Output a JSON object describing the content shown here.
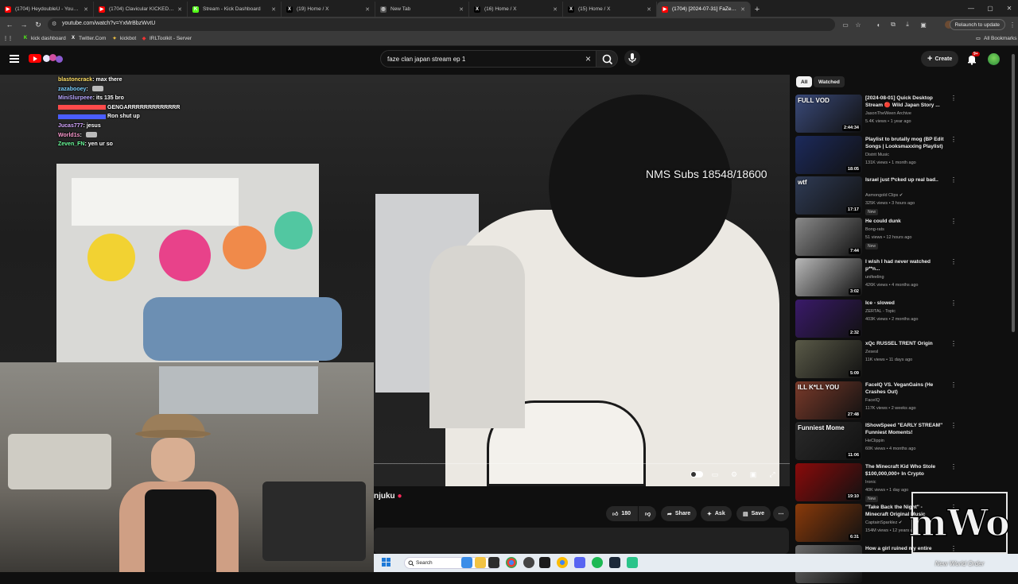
{
  "browser": {
    "tabs": [
      {
        "label": "(1704) HeydoubleU - YouTube",
        "fav": "▶",
        "favcolor": "#ff0000",
        "active": false
      },
      {
        "label": "(1704) Clavicular KICKED OUT",
        "fav": "▶",
        "favcolor": "#ff0000",
        "active": false
      },
      {
        "label": "Stream - Kick Dashboard",
        "fav": "K",
        "favcolor": "#53fc18",
        "active": false
      },
      {
        "label": "(19) Home / X",
        "fav": "X",
        "favcolor": "#000000",
        "active": false
      },
      {
        "label": "New Tab",
        "fav": "◎",
        "favcolor": "#555555",
        "active": false
      },
      {
        "label": "(16) Home / X",
        "fav": "X",
        "favcolor": "#000000",
        "active": false
      },
      {
        "label": "(15) Home / X",
        "fav": "X",
        "favcolor": "#000000",
        "active": false
      },
      {
        "label": "(1704) [2024-07-31] FaZe J...",
        "fav": "▶",
        "favcolor": "#ff0000",
        "active": true
      }
    ],
    "url": "youtube.com/watch?v=YxMrBbzWvtU",
    "relaunch_label": "Relaunch to update",
    "bookmarks": [
      {
        "label": "kick dashboard",
        "icon": "K",
        "color": "#53fc18"
      },
      {
        "label": "Twitter.Com",
        "icon": "X",
        "color": "#ffffff"
      },
      {
        "label": "kickbot",
        "icon": "✦",
        "color": "#f5c542"
      },
      {
        "label": "IRLToolkit - Server",
        "icon": "◆",
        "color": "#e33"
      }
    ],
    "all_bookmarks_label": "All Bookmarks"
  },
  "youtube": {
    "search_query": "faze clan japan stream ep 1",
    "create_label": "Create",
    "notif_count": "9+",
    "video_title_fragment": "njuku",
    "like_count": "180",
    "share_label": "Share",
    "ask_label": "Ask",
    "save_label": "Save"
  },
  "overlay": {
    "subs_counter": "NMS Subs 18548/18600",
    "chat": [
      {
        "user": "blastoncrack",
        "text": "max there",
        "color": "#ffe066"
      },
      {
        "user": "zazabooey",
        "text": "",
        "color": "#7ad1ff"
      },
      {
        "user": "MiniSlurpeee",
        "text": "its 135 bro",
        "color": "#b9a7ff"
      },
      {
        "user": "",
        "text": "GENGARRRRRRRRRRRRR",
        "color": "#ff4a4a"
      },
      {
        "user": "",
        "text": "Ron shut up",
        "color": "#4a5dff"
      },
      {
        "user": "Jucas777",
        "text": "jesus",
        "color": "#d6a7ff"
      },
      {
        "user": "World1s",
        "text": "",
        "color": "#ff9bd1"
      },
      {
        "user": "Zeven_FN",
        "text": "yen ur so",
        "color": "#6cff9c"
      }
    ]
  },
  "sidebar": {
    "chips": [
      "All",
      "Watched"
    ],
    "videos": [
      {
        "title": "[2024-08-01] Quick Desktop Stream 🔴 Wild Japan Story ...",
        "channel": "JasonTheWeen Archive",
        "views": "5.4K views • 1 year ago",
        "duration": "2:44:34",
        "new": false,
        "thumbcolor": "#3a4a7a",
        "thumbtext": "FULL VOD"
      },
      {
        "title": "Playlist to brutally mog (BP Edit Songs | Looksmaxxing Playlist)",
        "channel": "Distrit Music",
        "views": "131K views • 1 month ago",
        "duration": "18:05",
        "new": false,
        "thumbcolor": "#1c2a5c",
        "thumbtext": ""
      },
      {
        "title": "Israel just f*cked up real bad..",
        "channel": "Asmongold Clips ✔",
        "views": "325K views • 3 hours ago",
        "duration": "17:17",
        "new": true,
        "thumbcolor": "#2f3b55",
        "thumbtext": "wtf"
      },
      {
        "title": "He could dunk",
        "channel": "Bong-rats",
        "views": "51 views • 12 hours ago",
        "duration": "7:44",
        "new": true,
        "thumbcolor": "#8a8a8a",
        "thumbtext": ""
      },
      {
        "title": "I wish I had never watched p**n...",
        "channel": "unifeeling",
        "views": "426K views • 4 months ago",
        "duration": "3:02",
        "new": false,
        "thumbcolor": "#b9b9b9",
        "thumbtext": ""
      },
      {
        "title": "Ice - slowed",
        "channel": "ZERTAL - Topic",
        "views": "403K views • 2 months ago",
        "duration": "2:32",
        "new": false,
        "thumbcolor": "#3a1a6a",
        "thumbtext": ""
      },
      {
        "title": "xQc RUSSEL TRENT Origin",
        "channel": "Zesesl",
        "views": "11K views • 11 days ago",
        "duration": "5:09",
        "new": false,
        "thumbcolor": "#5a5a48",
        "thumbtext": ""
      },
      {
        "title": "FaceIQ VS. VeganGains (He Crashes Out)",
        "channel": "FaceIQ",
        "views": "117K views • 2 weeks ago",
        "duration": "27:48",
        "new": false,
        "thumbcolor": "#7a3a2a",
        "thumbtext": "ILL K*LL YOU"
      },
      {
        "title": "IShowSpeed \"EARLY STREAM\" Funniest Moments!",
        "channel": "HeClippin",
        "views": "60K views • 4 months ago",
        "duration": "11:06",
        "new": false,
        "thumbcolor": "#2a2a2a",
        "thumbtext": "Funniest Mome"
      },
      {
        "title": "The Minecraft Kid Who Stole $100,000,000+ In Crypto",
        "channel": "Ironic",
        "views": "40K views • 1 day ago",
        "duration": "19:10",
        "new": true,
        "thumbcolor": "#8a0a0a",
        "thumbtext": ""
      },
      {
        "title": "\"Take Back the Night\" - Minecraft Original Music",
        "channel": "CaptainSparklez ✔",
        "views": "154M views • 12 years ago",
        "duration": "6:31",
        "new": false,
        "thumbcolor": "#8a3a0a",
        "thumbtext": ""
      },
      {
        "title": "How a girl ruined my entire",
        "channel": "",
        "views": "",
        "duration": "",
        "new": false,
        "thumbcolor": "#6a6a6a",
        "thumbtext": ""
      }
    ]
  },
  "taskbar": {
    "search_placeholder": "Search"
  },
  "watermark": {
    "logo": "mWo",
    "text": "New World Order"
  }
}
